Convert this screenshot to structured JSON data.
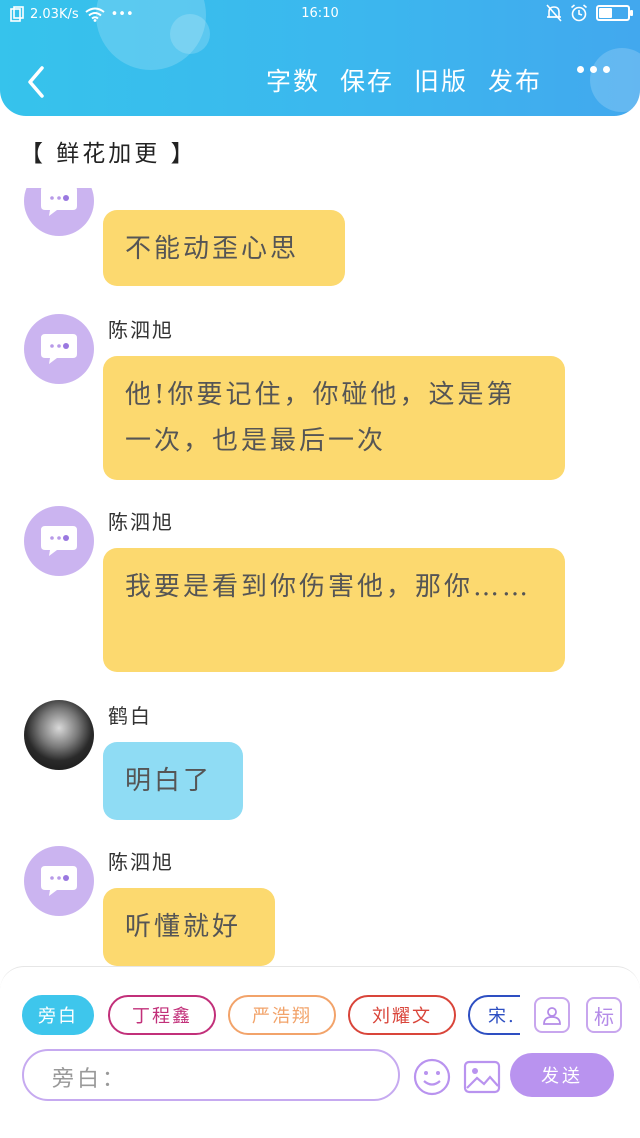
{
  "status_bar": {
    "net_speed": "2.03K/s",
    "time": "16:10",
    "dots": "•••",
    "battery_level": 0.45
  },
  "header": {
    "toolbar": [
      "字数",
      "保存",
      "旧版",
      "发布"
    ]
  },
  "tagline": "【 鲜花加更 】",
  "messages": [
    {
      "name": "",
      "text": "不能动歪心思",
      "color": "yellow"
    },
    {
      "name": "陈泗旭",
      "text": "他!你要记住，你碰他，这是第一次，也是最后一次",
      "color": "yellow"
    },
    {
      "name": "陈泗旭",
      "text": "我要是看到你伤害他，那你……",
      "color": "yellow"
    },
    {
      "name": "鹤白",
      "text": "明白了",
      "color": "blue"
    },
    {
      "name": "陈泗旭",
      "text": "听懂就好",
      "color": "yellow"
    }
  ],
  "roles": [
    "旁白",
    "丁程鑫",
    "严浩翔",
    "刘耀文",
    "宋."
  ],
  "role_colors": [
    "#3ec6ec",
    "#c2307a",
    "#f2a36a",
    "#d9453a",
    "#2e4fc2"
  ],
  "side_icons": {
    "person": "person-icon",
    "tag": "标"
  },
  "input": {
    "placeholder": "旁白："
  },
  "send_label": "发送",
  "colors": {
    "header": "#3cb6ee",
    "yellow_bubble": "#fcd96f",
    "blue_bubble": "#8fdcf4",
    "accent": "#b993ef"
  }
}
